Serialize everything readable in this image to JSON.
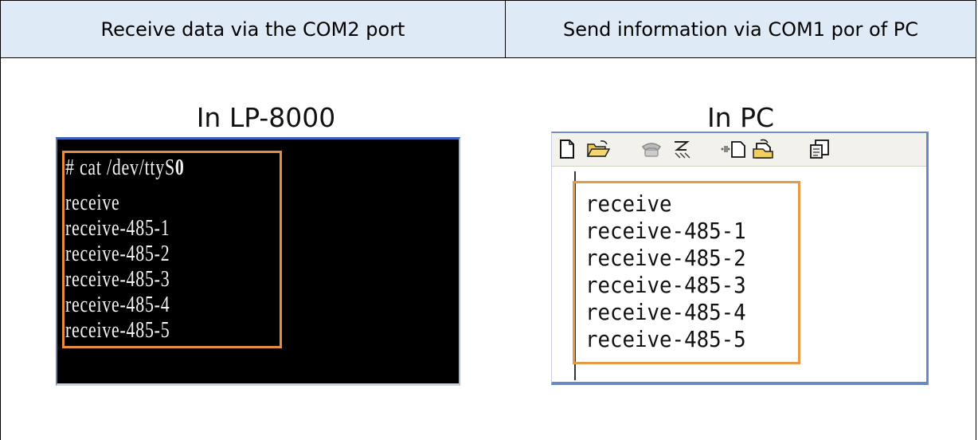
{
  "table": {
    "header_left": "Receive data via the COM2 port",
    "header_right": "Send information via COM1 por of PC"
  },
  "left_panel": {
    "title": "In LP-8000",
    "command_prefix": "# cat /dev/ttyS",
    "command_suffix": "0",
    "lines": [
      "receive",
      "receive-485-1",
      "receive-485-2",
      "receive-485-3",
      "receive-485-4",
      "receive-485-5"
    ]
  },
  "right_panel": {
    "title": "In PC",
    "toolbar_icons": [
      "new-document-icon",
      "open-folder-icon",
      "phone-icon",
      "disconnect-icon",
      "send-file-icon",
      "receive-file-icon",
      "properties-icon"
    ],
    "lines": [
      "receive",
      "receive-485-1",
      "receive-485-2",
      "receive-485-3",
      "receive-485-4",
      "receive-485-5"
    ]
  },
  "colors": {
    "header_background": "#deeaf6",
    "highlight_frame": "#e59a45",
    "terminal_background": "#000000",
    "window_border": "#6a89c4"
  }
}
